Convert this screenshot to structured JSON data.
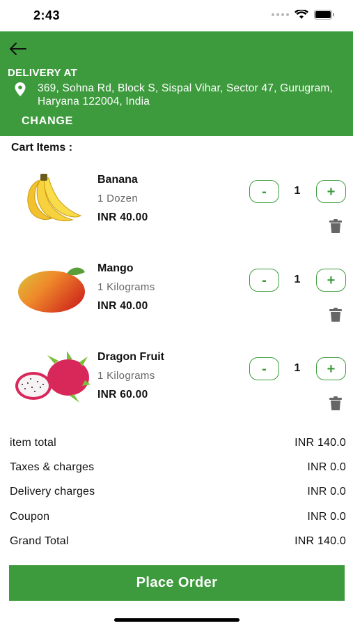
{
  "status_bar": {
    "time": "2:43"
  },
  "header": {
    "delivery_label": "DELIVERY AT",
    "address": "369, Sohna Rd, Block S, Sispal Vihar, Sector 47, Gurugram, Haryana 122004, India",
    "change_label": "CHANGE"
  },
  "cart": {
    "title": "Cart Items :",
    "items": [
      {
        "name": "Banana",
        "quantity_unit": "1 Dozen",
        "price": "INR 40.00",
        "count": "1",
        "minus": "-",
        "plus": "+",
        "icon": "banana-image"
      },
      {
        "name": "Mango",
        "quantity_unit": "1 Kilograms",
        "price": "INR 40.00",
        "count": "1",
        "minus": "-",
        "plus": "+",
        "icon": "mango-image"
      },
      {
        "name": "Dragon Fruit",
        "quantity_unit": "1 Kilograms",
        "price": "INR 60.00",
        "count": "1",
        "minus": "-",
        "plus": "+",
        "icon": "dragon-fruit-image"
      }
    ]
  },
  "summary": {
    "rows": [
      {
        "label": "item total",
        "value": "INR 140.0"
      },
      {
        "label": "Taxes & charges",
        "value": "INR 0.0"
      },
      {
        "label": "Delivery charges",
        "value": "INR 0.0"
      },
      {
        "label": "Coupon",
        "value": "INR 0.0"
      },
      {
        "label": "Grand Total",
        "value": "INR 140.0"
      }
    ]
  },
  "place_order_label": "Place Order",
  "colors": {
    "brand_green": "#3d9b3d",
    "trash_gray": "#666666"
  }
}
